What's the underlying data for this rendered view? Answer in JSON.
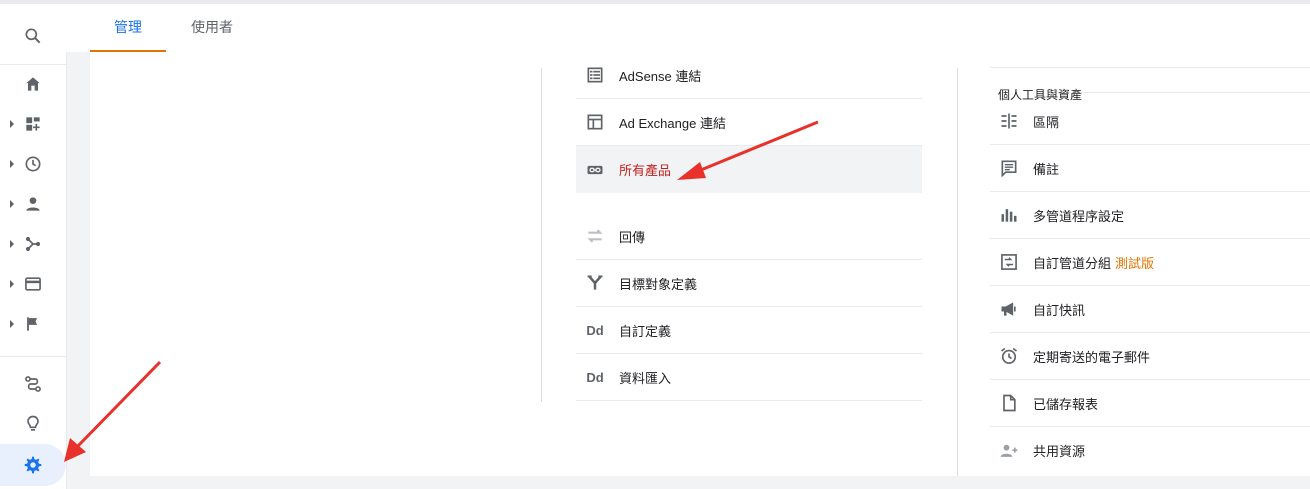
{
  "tabs": [
    {
      "label": "管理",
      "active": true
    },
    {
      "label": "使用者",
      "active": false
    }
  ],
  "rail": {
    "icons": [
      "search-icon",
      "home-icon",
      "dashboard-icon",
      "clock-icon",
      "person-icon",
      "acquisition-icon",
      "behavior-icon",
      "flag-icon",
      "attribution-icon",
      "lightbulb-icon",
      "gear-icon"
    ],
    "active": "gear-icon"
  },
  "middle_column": {
    "items": [
      {
        "label": "AdSense 連結",
        "icon": "list-icon"
      },
      {
        "label": "Ad Exchange 連結",
        "icon": "layout-icon"
      },
      {
        "label": "所有產品",
        "icon": "link-icon",
        "selected": true
      },
      {
        "label": "回傳",
        "icon": "swap-icon"
      },
      {
        "label": "目標對象定義",
        "icon": "fork-icon"
      },
      {
        "label": "自訂定義",
        "icon": "dd-icon"
      },
      {
        "label": "資料匯入",
        "icon": "dd-icon"
      }
    ],
    "dd_glyph": "Dd"
  },
  "right_column": {
    "section_title": "個人工具與資產",
    "items": [
      {
        "label": "區隔",
        "icon": "segments-icon"
      },
      {
        "label": "備註",
        "icon": "comment-icon"
      },
      {
        "label": "多管道程序設定",
        "icon": "bar-chart-icon"
      },
      {
        "label": "自訂管道分組",
        "badge": "測試版",
        "icon": "channel-group-icon"
      },
      {
        "label": "自訂快訊",
        "icon": "megaphone-icon"
      },
      {
        "label": "定期寄送的電子郵件",
        "icon": "alarm-icon"
      },
      {
        "label": "已儲存報表",
        "icon": "document-icon"
      },
      {
        "label": "共用資源",
        "icon": "person-add-icon"
      }
    ]
  },
  "colors": {
    "accent": "#1a73e8",
    "tab_underline": "#e37400",
    "selected_text": "#c5221f",
    "beta": "#e37400",
    "arrow": "#e8312a"
  }
}
